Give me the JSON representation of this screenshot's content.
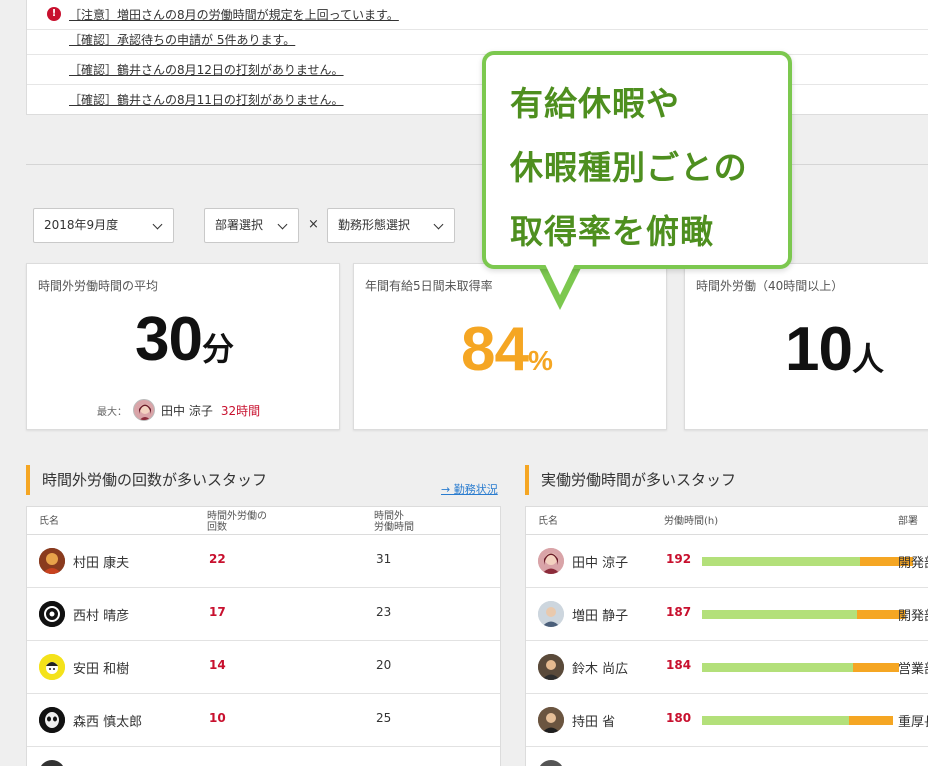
{
  "notices": [
    {
      "text": "［注意］増田さんの8月の労働時間が規定を上回っています。",
      "alert": true
    },
    {
      "text": "［確認］承認待ちの申請が 5件あります。",
      "alert": false
    },
    {
      "text": "［確認］鶴井さんの8月12日の打刻がありません。",
      "alert": false
    },
    {
      "text": "［確認］鶴井さんの8月11日の打刻がありません。",
      "alert": false
    }
  ],
  "filters": {
    "period": "2018年9月度",
    "department": "部署選択",
    "times": "×",
    "work_type": "勤務形態選択"
  },
  "cards": {
    "overtime_avg": {
      "title": "時間外労働時間の平均",
      "value": "30",
      "unit": "分",
      "max_label": "最大：",
      "max_name": "田中 涼子",
      "max_value": "32時間"
    },
    "paid_leave": {
      "title": "年間有給5日間未取得率",
      "value": "84",
      "unit": "%"
    },
    "overtime_40": {
      "title": "時間外労働（40時間以上）",
      "value": "10",
      "unit": "人"
    }
  },
  "bubble": {
    "lines": [
      "有給休暇や",
      "休暇種別ごとの",
      "取得率を俯瞰"
    ]
  },
  "overtime_table": {
    "title": "時間外労働の回数が多いスタッフ",
    "link": "→ 勤務状況",
    "headers": {
      "name": "氏名",
      "count_1": "時間外労働の",
      "count_2": "回数",
      "hours_1": "時間外",
      "hours_2": "労働時間"
    },
    "rows": [
      {
        "name": "村田 康夫",
        "count": "22",
        "hours": "31"
      },
      {
        "name": "西村 晴彦",
        "count": "17",
        "hours": "23"
      },
      {
        "name": "安田 和樹",
        "count": "14",
        "hours": "20"
      },
      {
        "name": "森西 慎太郎",
        "count": "10",
        "hours": "25"
      }
    ]
  },
  "work_table": {
    "title": "実働労働時間が多いスタッフ",
    "headers": {
      "name": "氏名",
      "hours": "労働時間(h)",
      "dept": "部署"
    },
    "rows": [
      {
        "name": "田中 涼子",
        "hours": "192",
        "dept": "開発部",
        "regular_fraction": 0.75,
        "over_fraction": 0.25
      },
      {
        "name": "増田 静子",
        "hours": "187",
        "dept": "開発部",
        "regular_fraction": 0.74,
        "over_fraction": 0.23
      },
      {
        "name": "鈴木 尚広",
        "hours": "184",
        "dept": "営業部",
        "regular_fraction": 0.72,
        "over_fraction": 0.22
      },
      {
        "name": "持田 省",
        "hours": "180",
        "dept": "重厚長",
        "regular_fraction": 0.7,
        "over_fraction": 0.21
      }
    ]
  },
  "colors": {
    "accent_orange": "#f5a623",
    "alert_red": "#c8102e",
    "bubble_green": "#7cc84f",
    "bar_green": "#b3e07a"
  }
}
